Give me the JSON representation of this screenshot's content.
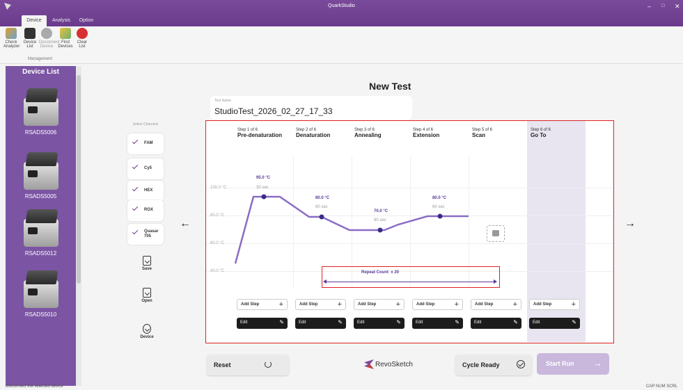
{
  "window": {
    "title": "QuarkStudio",
    "controls": [
      "–",
      "□",
      "✕"
    ]
  },
  "tabs": [
    {
      "label": "Device"
    },
    {
      "label": "Analysis"
    },
    {
      "label": "Option"
    }
  ],
  "ribbon": {
    "buttons": [
      {
        "label": "Check Analyzer",
        "icon": "analyzer-icon"
      },
      {
        "label": "Device List",
        "icon": "device-list-icon"
      },
      {
        "label": "Disconnect Device",
        "icon": "disconnect-icon"
      },
      {
        "label": "Find Devices",
        "icon": "find-devices-icon"
      },
      {
        "label": "Clear List",
        "icon": "clear-list-icon"
      }
    ],
    "group_label": "Management"
  },
  "sidebar": {
    "title": "Device List",
    "devices": [
      {
        "name": "RSADS5006"
      },
      {
        "name": "RSADS5005"
      },
      {
        "name": "RSADS5012"
      },
      {
        "name": "RSADS5010"
      }
    ]
  },
  "statusbar": {
    "left": "Disconnect the selected device",
    "right": "CAP NUM SCRL"
  },
  "main": {
    "title": "New Test",
    "test_name": {
      "label": "Test Name",
      "value": "StudioTest_2026_02_27_17_33"
    }
  },
  "channels": {
    "title": "Select Channels",
    "items": [
      {
        "name": "FAM",
        "checked": true
      },
      {
        "name": "Cy5",
        "checked": true
      },
      {
        "name": "HEX",
        "checked": true
      },
      {
        "name": "ROX",
        "checked": true
      },
      {
        "name": "Quasar",
        "name2": "705",
        "checked": true
      }
    ]
  },
  "side_actions": [
    {
      "label": "Save"
    },
    {
      "label": "Open"
    },
    {
      "label": "Device"
    }
  ],
  "protocol": {
    "y_labels": [
      "100.0 °C",
      "80.0 °C",
      "60.0 °C",
      "40.0 °C"
    ],
    "steps": [
      {
        "step_no": "Step 1 of 6",
        "name": "Pre-denaturation",
        "temp": "95.0 °C",
        "duration": "30 sec"
      },
      {
        "step_no": "Step 2 of 6",
        "name": "Denaturation",
        "temp": "80.0 °C",
        "duration": "60 sec"
      },
      {
        "step_no": "Step 3 of 6",
        "name": "Annealing",
        "temp": "70.0 °C",
        "duration": "60 sec"
      },
      {
        "step_no": "Step 4 of 6",
        "name": "Extension",
        "temp": "80.0 °C",
        "duration": "60 sec"
      },
      {
        "step_no": "Step 5 of 6",
        "name": "Scan",
        "temp": "",
        "duration": ""
      },
      {
        "step_no": "Step 6 of 6",
        "name": "Go To",
        "temp": "",
        "duration": ""
      }
    ],
    "repeat": {
      "label": "Repeat Count",
      "count": "x 20"
    },
    "add_step_label": "Add Step",
    "edit_label": "Edit"
  },
  "footer": {
    "reset_label": "Reset",
    "logo_text": "RevoSketch",
    "cycle_ready_label": "Cycle Ready",
    "start_run_label": "Start Run"
  },
  "colors": {
    "accent": "#6a3a8c",
    "sidebar": "#7b54a3",
    "highlight": "#e02020",
    "curve": "#8a6cc4"
  }
}
